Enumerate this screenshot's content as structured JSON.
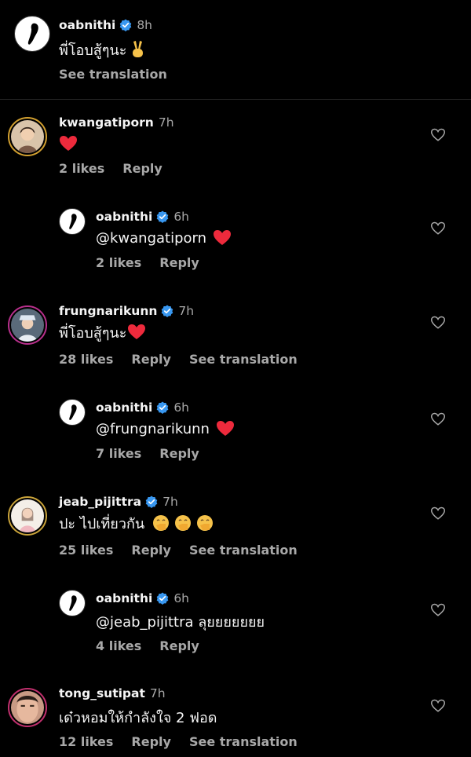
{
  "caption": {
    "username": "oabnithi",
    "time": "8h",
    "text": "พี่โอบสู้ๆนะ",
    "emoji": "victory-hand-emoji",
    "see_translation": "See translation"
  },
  "comments": [
    {
      "username": "kwangatiporn",
      "time": "7h",
      "text": "",
      "emoji": "red-heart",
      "likes": "2 likes",
      "reply": "Reply",
      "see_translation": ""
    },
    {
      "username": "oabnithi",
      "time": "6h",
      "text": "@kwangatiporn",
      "emoji": "red-heart",
      "likes": "2 likes",
      "reply": "Reply",
      "see_translation": ""
    },
    {
      "username": "frungnarikunn",
      "time": "7h",
      "text": "พี่โอบสู้ๆนะ",
      "emoji": "red-heart",
      "likes": "28 likes",
      "reply": "Reply",
      "see_translation": "See translation"
    },
    {
      "username": "oabnithi",
      "time": "6h",
      "text": "@frungnarikunn",
      "emoji": "red-heart",
      "likes": "7 likes",
      "reply": "Reply",
      "see_translation": ""
    },
    {
      "username": "jeab_pijittra",
      "time": "7h",
      "text": "ปะ ไปเที่ยวกัน",
      "emoji": "hand-over-mouth x3",
      "likes": "25 likes",
      "reply": "Reply",
      "see_translation": "See translation"
    },
    {
      "username": "oabnithi",
      "time": "6h",
      "text": "@jeab_pijittra ลุยยยยยยย",
      "emoji": "",
      "likes": "4 likes",
      "reply": "Reply",
      "see_translation": ""
    },
    {
      "username": "tong_sutipat",
      "time": "7h",
      "text": "เด๋วหอมให้กำลังใจ 2 ฟอด",
      "emoji": "",
      "likes": "12 likes",
      "reply": "Reply",
      "see_translation": "See translation"
    }
  ],
  "colors": {
    "verified": "#3897f0",
    "heart": "#ed2a3c",
    "muted": "#a8a8a8"
  }
}
